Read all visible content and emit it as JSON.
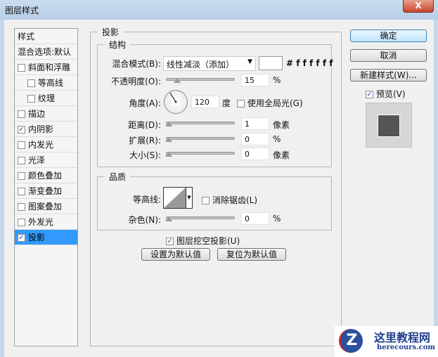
{
  "window": {
    "title": "图层样式",
    "close": "X"
  },
  "sidebar": {
    "items": [
      {
        "label": "样式",
        "checkbox": null,
        "indent": false
      },
      {
        "label": "混合选项:默认",
        "checkbox": null,
        "indent": false
      },
      {
        "label": "斜面和浮雕",
        "checkbox": false,
        "indent": false
      },
      {
        "label": "等高线",
        "checkbox": false,
        "indent": true
      },
      {
        "label": "纹理",
        "checkbox": false,
        "indent": true
      },
      {
        "label": "描边",
        "checkbox": false,
        "indent": false
      },
      {
        "label": "内阴影",
        "checkbox": true,
        "indent": false
      },
      {
        "label": "内发光",
        "checkbox": false,
        "indent": false
      },
      {
        "label": "光泽",
        "checkbox": false,
        "indent": false
      },
      {
        "label": "颜色叠加",
        "checkbox": false,
        "indent": false
      },
      {
        "label": "渐变叠加",
        "checkbox": false,
        "indent": false
      },
      {
        "label": "图案叠加",
        "checkbox": false,
        "indent": false
      },
      {
        "label": "外发光",
        "checkbox": false,
        "indent": false
      },
      {
        "label": "投影",
        "checkbox": true,
        "indent": false,
        "selected": true
      }
    ]
  },
  "panel": {
    "title": "投影",
    "structure": {
      "title": "结构",
      "blend_label": "混合模式(B):",
      "blend_value": "线性减淡（添加）",
      "color_hex": "# f f f f f f",
      "color": "#ffffff",
      "opacity_label": "不透明度(O):",
      "opacity": "15",
      "opacity_unit": "%",
      "angle_label": "角度(A):",
      "angle": "120",
      "angle_unit": "度",
      "global_light": "使用全局光(G)",
      "distance_label": "距离(D):",
      "distance": "1",
      "distance_unit": "像素",
      "spread_label": "扩展(R):",
      "spread": "0",
      "spread_unit": "%",
      "size_label": "大小(S):",
      "size": "0",
      "size_unit": "像素"
    },
    "quality": {
      "title": "品质",
      "contour_label": "等高线:",
      "antialias": "消除锯齿(L)",
      "noise_label": "杂色(N):",
      "noise": "0",
      "noise_unit": "%"
    },
    "knockout": "图层挖空投影(U)",
    "set_default": "设置为默认值",
    "reset_default": "复位为默认值"
  },
  "actions": {
    "ok": "确定",
    "cancel": "取消",
    "new_style": "新建样式(W)...",
    "preview": "预览(V)"
  },
  "watermark": {
    "name": "这里教程网",
    "url": "herecours.com"
  }
}
